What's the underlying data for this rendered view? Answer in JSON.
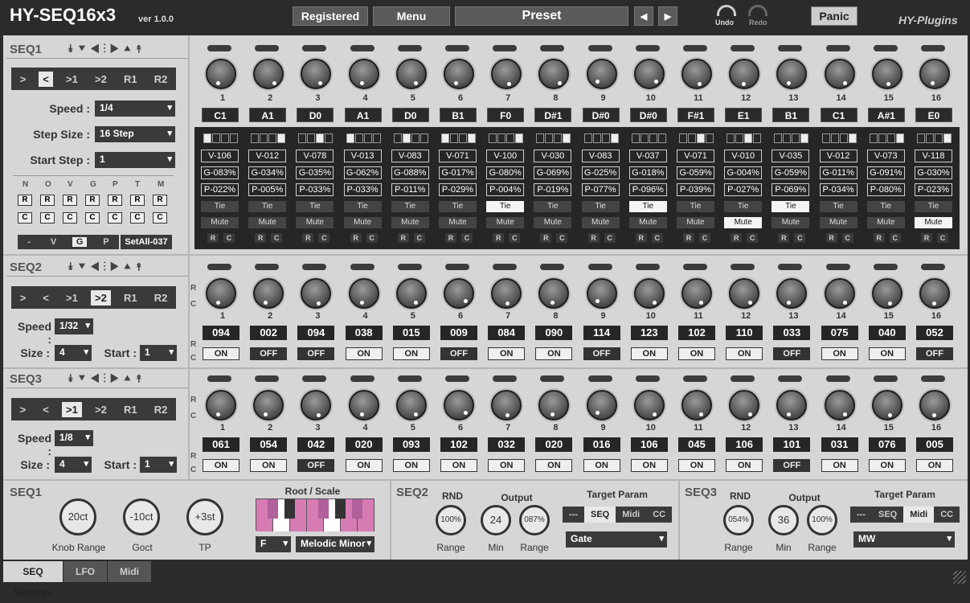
{
  "title": "HY-SEQ16x3",
  "version": "ver 1.0.0",
  "header": {
    "registered": "Registered",
    "menu": "Menu",
    "preset": "Preset",
    "prev": "◀",
    "next": "▶",
    "undo": "Undo",
    "redo": "Redo",
    "panic": "Panic",
    "brand": "HY-Plugins"
  },
  "seq1": {
    "name": "SEQ1",
    "nav": "⯯⯆◀⁝▶⯅⯭",
    "modes": [
      ">",
      "<",
      ">1",
      ">2",
      "R1",
      "R2"
    ],
    "mode_sel": 1,
    "speed_label": "Speed :",
    "speed": "1/4",
    "size_label": "Step Size :",
    "size": "16 Step",
    "start_label": "Start Step :",
    "start": "1",
    "cols": [
      "N",
      "O",
      "V",
      "G",
      "P",
      "T",
      "M"
    ],
    "r": "R",
    "c": "C",
    "vgp": [
      "-",
      "V",
      "G",
      "P"
    ],
    "vgp_sel": 2,
    "setall": "SetAll-037",
    "notes": [
      "C1",
      "A1",
      "D0",
      "A1",
      "D0",
      "B1",
      "F0",
      "D#1",
      "D#0",
      "D#0",
      "F#1",
      "E1",
      "B1",
      "C1",
      "A#1",
      "E0"
    ],
    "vel": [
      "V-106",
      "V-012",
      "V-078",
      "V-013",
      "V-083",
      "V-071",
      "V-100",
      "V-030",
      "V-083",
      "V-037",
      "V-071",
      "V-010",
      "V-035",
      "V-012",
      "V-073",
      "V-118"
    ],
    "gate": [
      "G-083%",
      "G-034%",
      "G-035%",
      "G-062%",
      "G-088%",
      "G-017%",
      "G-080%",
      "G-069%",
      "G-025%",
      "G-018%",
      "G-059%",
      "G-004%",
      "G-059%",
      "G-011%",
      "G-091%",
      "G-030%"
    ],
    "prob": [
      "P-022%",
      "P-005%",
      "P-033%",
      "P-033%",
      "P-011%",
      "P-029%",
      "P-004%",
      "P-019%",
      "P-077%",
      "P-096%",
      "P-039%",
      "P-027%",
      "P-069%",
      "P-034%",
      "P-080%",
      "P-023%"
    ],
    "tie_label": "Tie",
    "mute_label": "Mute",
    "tie_on": [
      7,
      10,
      13
    ],
    "mute_on": [
      12,
      16
    ],
    "squares": [
      [
        1,
        0,
        0,
        0
      ],
      [
        0,
        0,
        0,
        1
      ],
      [
        0,
        0,
        1,
        0
      ],
      [
        1,
        0,
        0,
        0
      ],
      [
        0,
        1,
        0,
        0
      ],
      [
        1,
        0,
        0,
        1
      ],
      [
        0,
        0,
        0,
        1
      ],
      [
        0,
        0,
        0,
        1
      ],
      [
        0,
        0,
        0,
        1
      ],
      [
        0,
        0,
        0,
        0
      ],
      [
        0,
        0,
        1,
        0
      ],
      [
        0,
        0,
        1,
        0
      ],
      [
        0,
        0,
        0,
        1
      ],
      [
        0,
        0,
        0,
        1
      ],
      [
        0,
        0,
        0,
        1
      ],
      [
        0,
        0,
        0,
        1
      ]
    ]
  },
  "seq2": {
    "name": "SEQ2",
    "modes": [
      ">",
      "<",
      ">1",
      ">2",
      "R1",
      "R2"
    ],
    "mode_sel": 3,
    "speed_label": "Speed :",
    "speed": "1/32",
    "size_label": "Size :",
    "size": "4",
    "start_label": "Start :",
    "start": "1",
    "values": [
      "094",
      "002",
      "094",
      "038",
      "015",
      "009",
      "084",
      "090",
      "114",
      "123",
      "102",
      "110",
      "033",
      "075",
      "040",
      "052"
    ],
    "onoff": [
      "ON",
      "OFF",
      "OFF",
      "ON",
      "ON",
      "OFF",
      "ON",
      "ON",
      "OFF",
      "ON",
      "ON",
      "ON",
      "OFF",
      "ON",
      "ON",
      "OFF"
    ]
  },
  "seq3": {
    "name": "SEQ3",
    "modes": [
      ">",
      "<",
      ">1",
      ">2",
      "R1",
      "R2"
    ],
    "mode_sel": 2,
    "speed_label": "Speed :",
    "speed": "1/8",
    "size_label": "Size :",
    "size": "4",
    "start_label": "Start :",
    "start": "1",
    "values": [
      "061",
      "054",
      "042",
      "020",
      "093",
      "102",
      "032",
      "020",
      "016",
      "106",
      "045",
      "106",
      "101",
      "031",
      "076",
      "005"
    ],
    "onoff": [
      "ON",
      "ON",
      "OFF",
      "ON",
      "ON",
      "ON",
      "ON",
      "ON",
      "ON",
      "ON",
      "ON",
      "ON",
      "OFF",
      "ON",
      "ON",
      "ON"
    ]
  },
  "bottom": {
    "seq1": "SEQ1",
    "knob_range": "20ct",
    "knob_range_label": "Knob Range",
    "goct": "-10ct",
    "goct_label": "Goct",
    "tp": "+3st",
    "tp_label": "TP",
    "root_scale": "Root / Scale",
    "root": "F",
    "scale": "Melodic Minor",
    "seq2": "SEQ2",
    "seq3": "SEQ3",
    "rnd": "RND",
    "output": "Output",
    "target": "Target Param",
    "s2_rnd": "100%",
    "s2_min": "24",
    "s2_range": "087%",
    "s3_rnd": "054%",
    "s3_min": "36",
    "s3_range": "100%",
    "range": "Range",
    "min": "Min",
    "s2_tabs": [
      "---",
      "SEQ",
      "Midi",
      "CC"
    ],
    "s2_tab_sel": 1,
    "s2_param": "Gate",
    "s3_tabs": [
      "---",
      "SEQ",
      "Midi",
      "CC"
    ],
    "s3_tab_sel": 2,
    "s3_param": "MW"
  },
  "tabs": [
    "SEQ Settings",
    "LFO",
    "Midi"
  ]
}
